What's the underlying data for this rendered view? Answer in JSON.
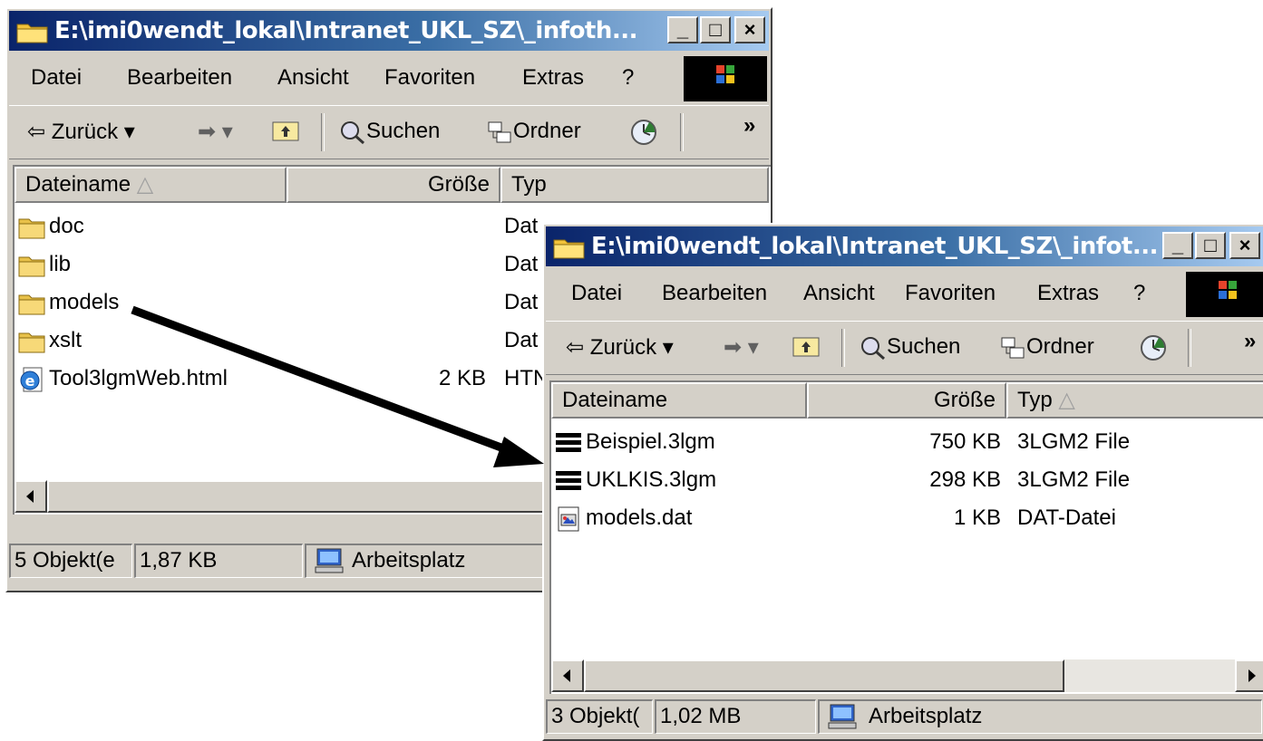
{
  "window1": {
    "title": "E:\\imi0wendt_lokal\\Intranet_UKL_SZ\\_infoth...",
    "menu": [
      "Datei",
      "Bearbeiten",
      "Ansicht",
      "Favoriten",
      "Extras",
      "?"
    ],
    "toolbar": {
      "back": "Zurück",
      "search": "Suchen",
      "folders": "Ordner",
      "more": "»"
    },
    "columns": {
      "name": "Dateiname",
      "size": "Größe",
      "type": "Typ"
    },
    "rows": [
      {
        "name": "doc",
        "size": "",
        "type": "Dat",
        "icon": "folder-icon"
      },
      {
        "name": "lib",
        "size": "",
        "type": "Dat",
        "icon": "folder-icon"
      },
      {
        "name": "models",
        "size": "",
        "type": "Dat",
        "icon": "folder-icon"
      },
      {
        "name": "xslt",
        "size": "",
        "type": "Dat",
        "icon": "folder-icon"
      },
      {
        "name": "Tool3lgmWeb.html",
        "size": "2 KB",
        "type": "HTN",
        "icon": "html-file-icon"
      }
    ],
    "status": {
      "count": "5 Objekt(e",
      "size": "1,87 KB",
      "location": "Arbeitsplatz"
    }
  },
  "window2": {
    "title": "E:\\imi0wendt_lokal\\Intranet_UKL_SZ\\_infot...",
    "menu": [
      "Datei",
      "Bearbeiten",
      "Ansicht",
      "Favoriten",
      "Extras",
      "?"
    ],
    "toolbar": {
      "back": "Zurück",
      "search": "Suchen",
      "folders": "Ordner",
      "more": "»"
    },
    "columns": {
      "name": "Dateiname",
      "size": "Größe",
      "type": "Typ"
    },
    "rows": [
      {
        "name": "Beispiel.3lgm",
        "size": "750 KB",
        "type": "3LGM2 File",
        "icon": "3lgm-file-icon"
      },
      {
        "name": "UKLKIS.3lgm",
        "size": "298 KB",
        "type": "3LGM2 File",
        "icon": "3lgm-file-icon"
      },
      {
        "name": "models.dat",
        "size": "1 KB",
        "type": "DAT-Datei",
        "icon": "dat-file-icon"
      }
    ],
    "status": {
      "count": "3 Objekt(",
      "size": "1,02 MB",
      "location": "Arbeitsplatz"
    }
  }
}
